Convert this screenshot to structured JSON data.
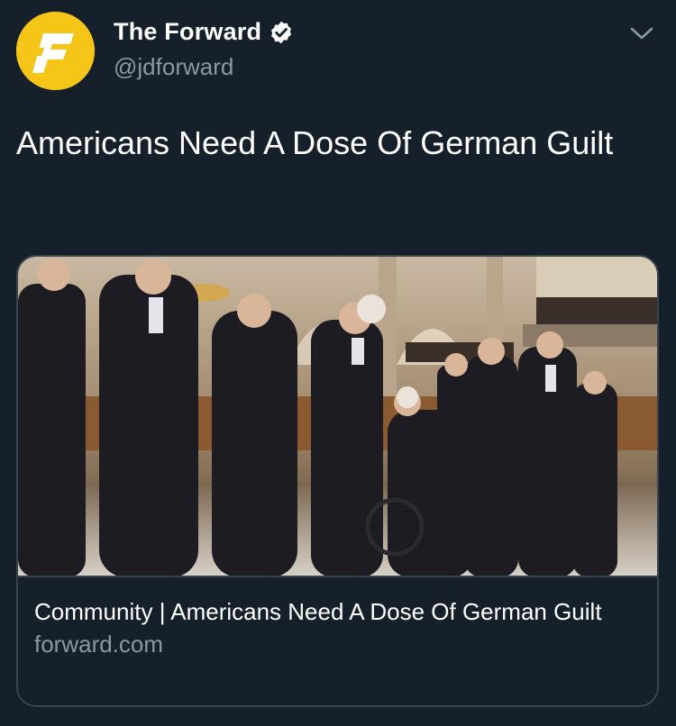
{
  "account": {
    "display_name": "The Forward",
    "handle": "@jdforward",
    "verified": true,
    "avatar_color": "#f5c518",
    "avatar_icon": "forward-logo-f"
  },
  "tweet": {
    "text": "Americans Need A Dose Of German Guilt"
  },
  "link_card": {
    "image_icon": "photo-dignitaries-synagogue",
    "title": "Community | Americans Need A Dose Of German Guilt",
    "domain": "forward.com"
  },
  "colors": {
    "background": "#15202b",
    "secondary_text": "#8899a6",
    "border": "#38444d",
    "verified_badge": "#ffffff"
  }
}
